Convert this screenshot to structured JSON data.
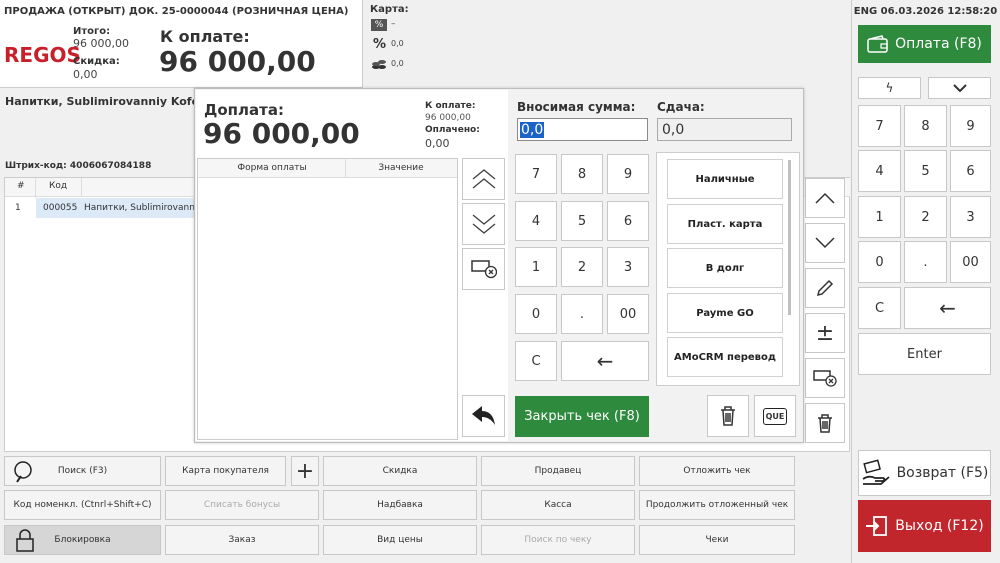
{
  "header": {
    "doc_title": "ПРОДАЖА (ОТКРЫТ) ДОК. 25-0000044  (РОЗНИЧНАЯ ЦЕНА)",
    "logo": "REGOS",
    "itogo_label": "Итого:",
    "itogo_value": "96 000,00",
    "skidka_label": "Скидка:",
    "skidka_value": "0,00",
    "k_oplate_label": "К оплате:",
    "k_oplate_value": "96 000,00"
  },
  "card": {
    "label": "Карта:",
    "pct_badge": "%",
    "dash": "–",
    "pct_value": "0,0",
    "coins_value": "0,0"
  },
  "product": {
    "name": "Напитки, Sublimirovanniy Kofe I",
    "barcode_label": "Штрих-код: 4006067084188"
  },
  "table": {
    "headers": [
      "#",
      "Код"
    ],
    "rows": [
      {
        "n": "1",
        "code": "000055",
        "name": "Напитки, Sublimirovanni"
      }
    ]
  },
  "status": {
    "lang_date": "ENG 06.03.2026 12:58:20"
  },
  "right": {
    "pay_label": "Оплата (F8)",
    "return_label": "Возврат (F5)",
    "exit_label": "Выход (F12)",
    "enter_label": "Enter",
    "keys": [
      "7",
      "8",
      "9",
      "4",
      "5",
      "6",
      "1",
      "2",
      "3",
      "0",
      ".",
      "00"
    ],
    "c_key": "C",
    "back_key": "←"
  },
  "dialog": {
    "title": "Доплата:",
    "amount": "96 000,00",
    "k_oplate_label": "К оплате:",
    "k_oplate_value": "96 000,00",
    "oplacheno_label": "Оплачено:",
    "oplacheno_value": "0,00",
    "col_form": "Форма оплаты",
    "col_value": "Значение",
    "vnosimaya_label": "Вносимая сумма:",
    "vnosimaya_value": "0,0",
    "sdacha_label": "Сдача:",
    "sdacha_value": "0,0",
    "keys": [
      "7",
      "8",
      "9",
      "4",
      "5",
      "6",
      "1",
      "2",
      "3",
      "0",
      ".",
      "00"
    ],
    "c_key": "C",
    "back_key": "←",
    "close_label": "Закрыть чек (F8)",
    "methods": [
      "Наличные",
      "Пласт. карта",
      "В долг",
      "Payme GO",
      "AMoCRM перевод"
    ],
    "que": "QUE"
  },
  "bottom": {
    "search": "Поиск (F3)",
    "card": "Карта покупателя",
    "discount": "Скидка",
    "seller": "Продавец",
    "postpone": "Отложить чек",
    "nomencl": "Код номенкл. (Ctnrl+Shift+C)",
    "bonus": "Списать бонусы",
    "markup": "Надбавка",
    "cashbox": "Касса",
    "continue": "Продолжить отложенный чек",
    "lock": "Блокировка",
    "order": "Заказ",
    "price_type": "Вид цены",
    "search_check": "Поиск по чеку",
    "checks": "Чеки"
  },
  "colors": {
    "green": "#2e8b3e",
    "red": "#c0262b",
    "regos_red": "#c8202a"
  }
}
